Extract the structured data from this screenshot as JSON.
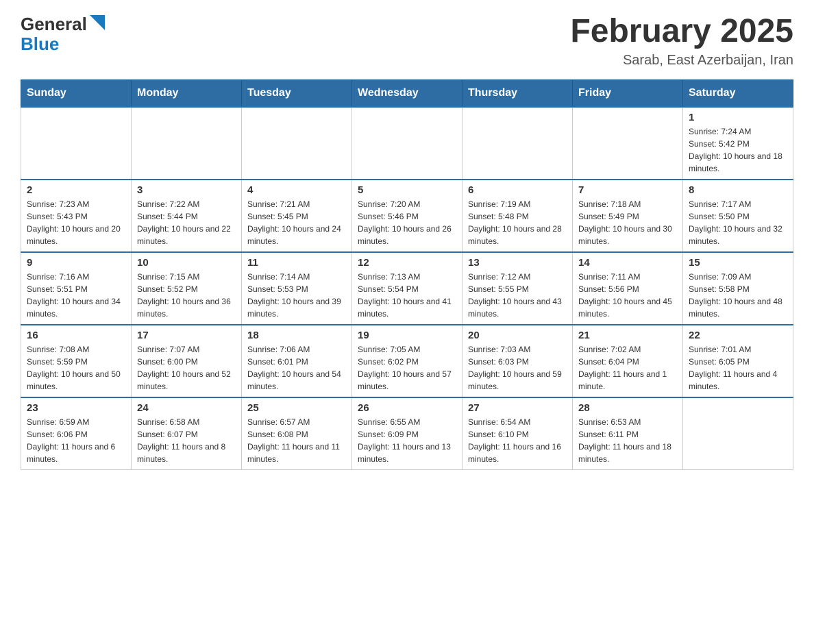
{
  "header": {
    "logo_general": "General",
    "logo_blue": "Blue",
    "month_title": "February 2025",
    "location": "Sarab, East Azerbaijan, Iran"
  },
  "days_of_week": [
    "Sunday",
    "Monday",
    "Tuesday",
    "Wednesday",
    "Thursday",
    "Friday",
    "Saturday"
  ],
  "weeks": [
    [
      {
        "day": "",
        "sunrise": "",
        "sunset": "",
        "daylight": ""
      },
      {
        "day": "",
        "sunrise": "",
        "sunset": "",
        "daylight": ""
      },
      {
        "day": "",
        "sunrise": "",
        "sunset": "",
        "daylight": ""
      },
      {
        "day": "",
        "sunrise": "",
        "sunset": "",
        "daylight": ""
      },
      {
        "day": "",
        "sunrise": "",
        "sunset": "",
        "daylight": ""
      },
      {
        "day": "",
        "sunrise": "",
        "sunset": "",
        "daylight": ""
      },
      {
        "day": "1",
        "sunrise": "Sunrise: 7:24 AM",
        "sunset": "Sunset: 5:42 PM",
        "daylight": "Daylight: 10 hours and 18 minutes."
      }
    ],
    [
      {
        "day": "2",
        "sunrise": "Sunrise: 7:23 AM",
        "sunset": "Sunset: 5:43 PM",
        "daylight": "Daylight: 10 hours and 20 minutes."
      },
      {
        "day": "3",
        "sunrise": "Sunrise: 7:22 AM",
        "sunset": "Sunset: 5:44 PM",
        "daylight": "Daylight: 10 hours and 22 minutes."
      },
      {
        "day": "4",
        "sunrise": "Sunrise: 7:21 AM",
        "sunset": "Sunset: 5:45 PM",
        "daylight": "Daylight: 10 hours and 24 minutes."
      },
      {
        "day": "5",
        "sunrise": "Sunrise: 7:20 AM",
        "sunset": "Sunset: 5:46 PM",
        "daylight": "Daylight: 10 hours and 26 minutes."
      },
      {
        "day": "6",
        "sunrise": "Sunrise: 7:19 AM",
        "sunset": "Sunset: 5:48 PM",
        "daylight": "Daylight: 10 hours and 28 minutes."
      },
      {
        "day": "7",
        "sunrise": "Sunrise: 7:18 AM",
        "sunset": "Sunset: 5:49 PM",
        "daylight": "Daylight: 10 hours and 30 minutes."
      },
      {
        "day": "8",
        "sunrise": "Sunrise: 7:17 AM",
        "sunset": "Sunset: 5:50 PM",
        "daylight": "Daylight: 10 hours and 32 minutes."
      }
    ],
    [
      {
        "day": "9",
        "sunrise": "Sunrise: 7:16 AM",
        "sunset": "Sunset: 5:51 PM",
        "daylight": "Daylight: 10 hours and 34 minutes."
      },
      {
        "day": "10",
        "sunrise": "Sunrise: 7:15 AM",
        "sunset": "Sunset: 5:52 PM",
        "daylight": "Daylight: 10 hours and 36 minutes."
      },
      {
        "day": "11",
        "sunrise": "Sunrise: 7:14 AM",
        "sunset": "Sunset: 5:53 PM",
        "daylight": "Daylight: 10 hours and 39 minutes."
      },
      {
        "day": "12",
        "sunrise": "Sunrise: 7:13 AM",
        "sunset": "Sunset: 5:54 PM",
        "daylight": "Daylight: 10 hours and 41 minutes."
      },
      {
        "day": "13",
        "sunrise": "Sunrise: 7:12 AM",
        "sunset": "Sunset: 5:55 PM",
        "daylight": "Daylight: 10 hours and 43 minutes."
      },
      {
        "day": "14",
        "sunrise": "Sunrise: 7:11 AM",
        "sunset": "Sunset: 5:56 PM",
        "daylight": "Daylight: 10 hours and 45 minutes."
      },
      {
        "day": "15",
        "sunrise": "Sunrise: 7:09 AM",
        "sunset": "Sunset: 5:58 PM",
        "daylight": "Daylight: 10 hours and 48 minutes."
      }
    ],
    [
      {
        "day": "16",
        "sunrise": "Sunrise: 7:08 AM",
        "sunset": "Sunset: 5:59 PM",
        "daylight": "Daylight: 10 hours and 50 minutes."
      },
      {
        "day": "17",
        "sunrise": "Sunrise: 7:07 AM",
        "sunset": "Sunset: 6:00 PM",
        "daylight": "Daylight: 10 hours and 52 minutes."
      },
      {
        "day": "18",
        "sunrise": "Sunrise: 7:06 AM",
        "sunset": "Sunset: 6:01 PM",
        "daylight": "Daylight: 10 hours and 54 minutes."
      },
      {
        "day": "19",
        "sunrise": "Sunrise: 7:05 AM",
        "sunset": "Sunset: 6:02 PM",
        "daylight": "Daylight: 10 hours and 57 minutes."
      },
      {
        "day": "20",
        "sunrise": "Sunrise: 7:03 AM",
        "sunset": "Sunset: 6:03 PM",
        "daylight": "Daylight: 10 hours and 59 minutes."
      },
      {
        "day": "21",
        "sunrise": "Sunrise: 7:02 AM",
        "sunset": "Sunset: 6:04 PM",
        "daylight": "Daylight: 11 hours and 1 minute."
      },
      {
        "day": "22",
        "sunrise": "Sunrise: 7:01 AM",
        "sunset": "Sunset: 6:05 PM",
        "daylight": "Daylight: 11 hours and 4 minutes."
      }
    ],
    [
      {
        "day": "23",
        "sunrise": "Sunrise: 6:59 AM",
        "sunset": "Sunset: 6:06 PM",
        "daylight": "Daylight: 11 hours and 6 minutes."
      },
      {
        "day": "24",
        "sunrise": "Sunrise: 6:58 AM",
        "sunset": "Sunset: 6:07 PM",
        "daylight": "Daylight: 11 hours and 8 minutes."
      },
      {
        "day": "25",
        "sunrise": "Sunrise: 6:57 AM",
        "sunset": "Sunset: 6:08 PM",
        "daylight": "Daylight: 11 hours and 11 minutes."
      },
      {
        "day": "26",
        "sunrise": "Sunrise: 6:55 AM",
        "sunset": "Sunset: 6:09 PM",
        "daylight": "Daylight: 11 hours and 13 minutes."
      },
      {
        "day": "27",
        "sunrise": "Sunrise: 6:54 AM",
        "sunset": "Sunset: 6:10 PM",
        "daylight": "Daylight: 11 hours and 16 minutes."
      },
      {
        "day": "28",
        "sunrise": "Sunrise: 6:53 AM",
        "sunset": "Sunset: 6:11 PM",
        "daylight": "Daylight: 11 hours and 18 minutes."
      },
      {
        "day": "",
        "sunrise": "",
        "sunset": "",
        "daylight": ""
      }
    ]
  ]
}
